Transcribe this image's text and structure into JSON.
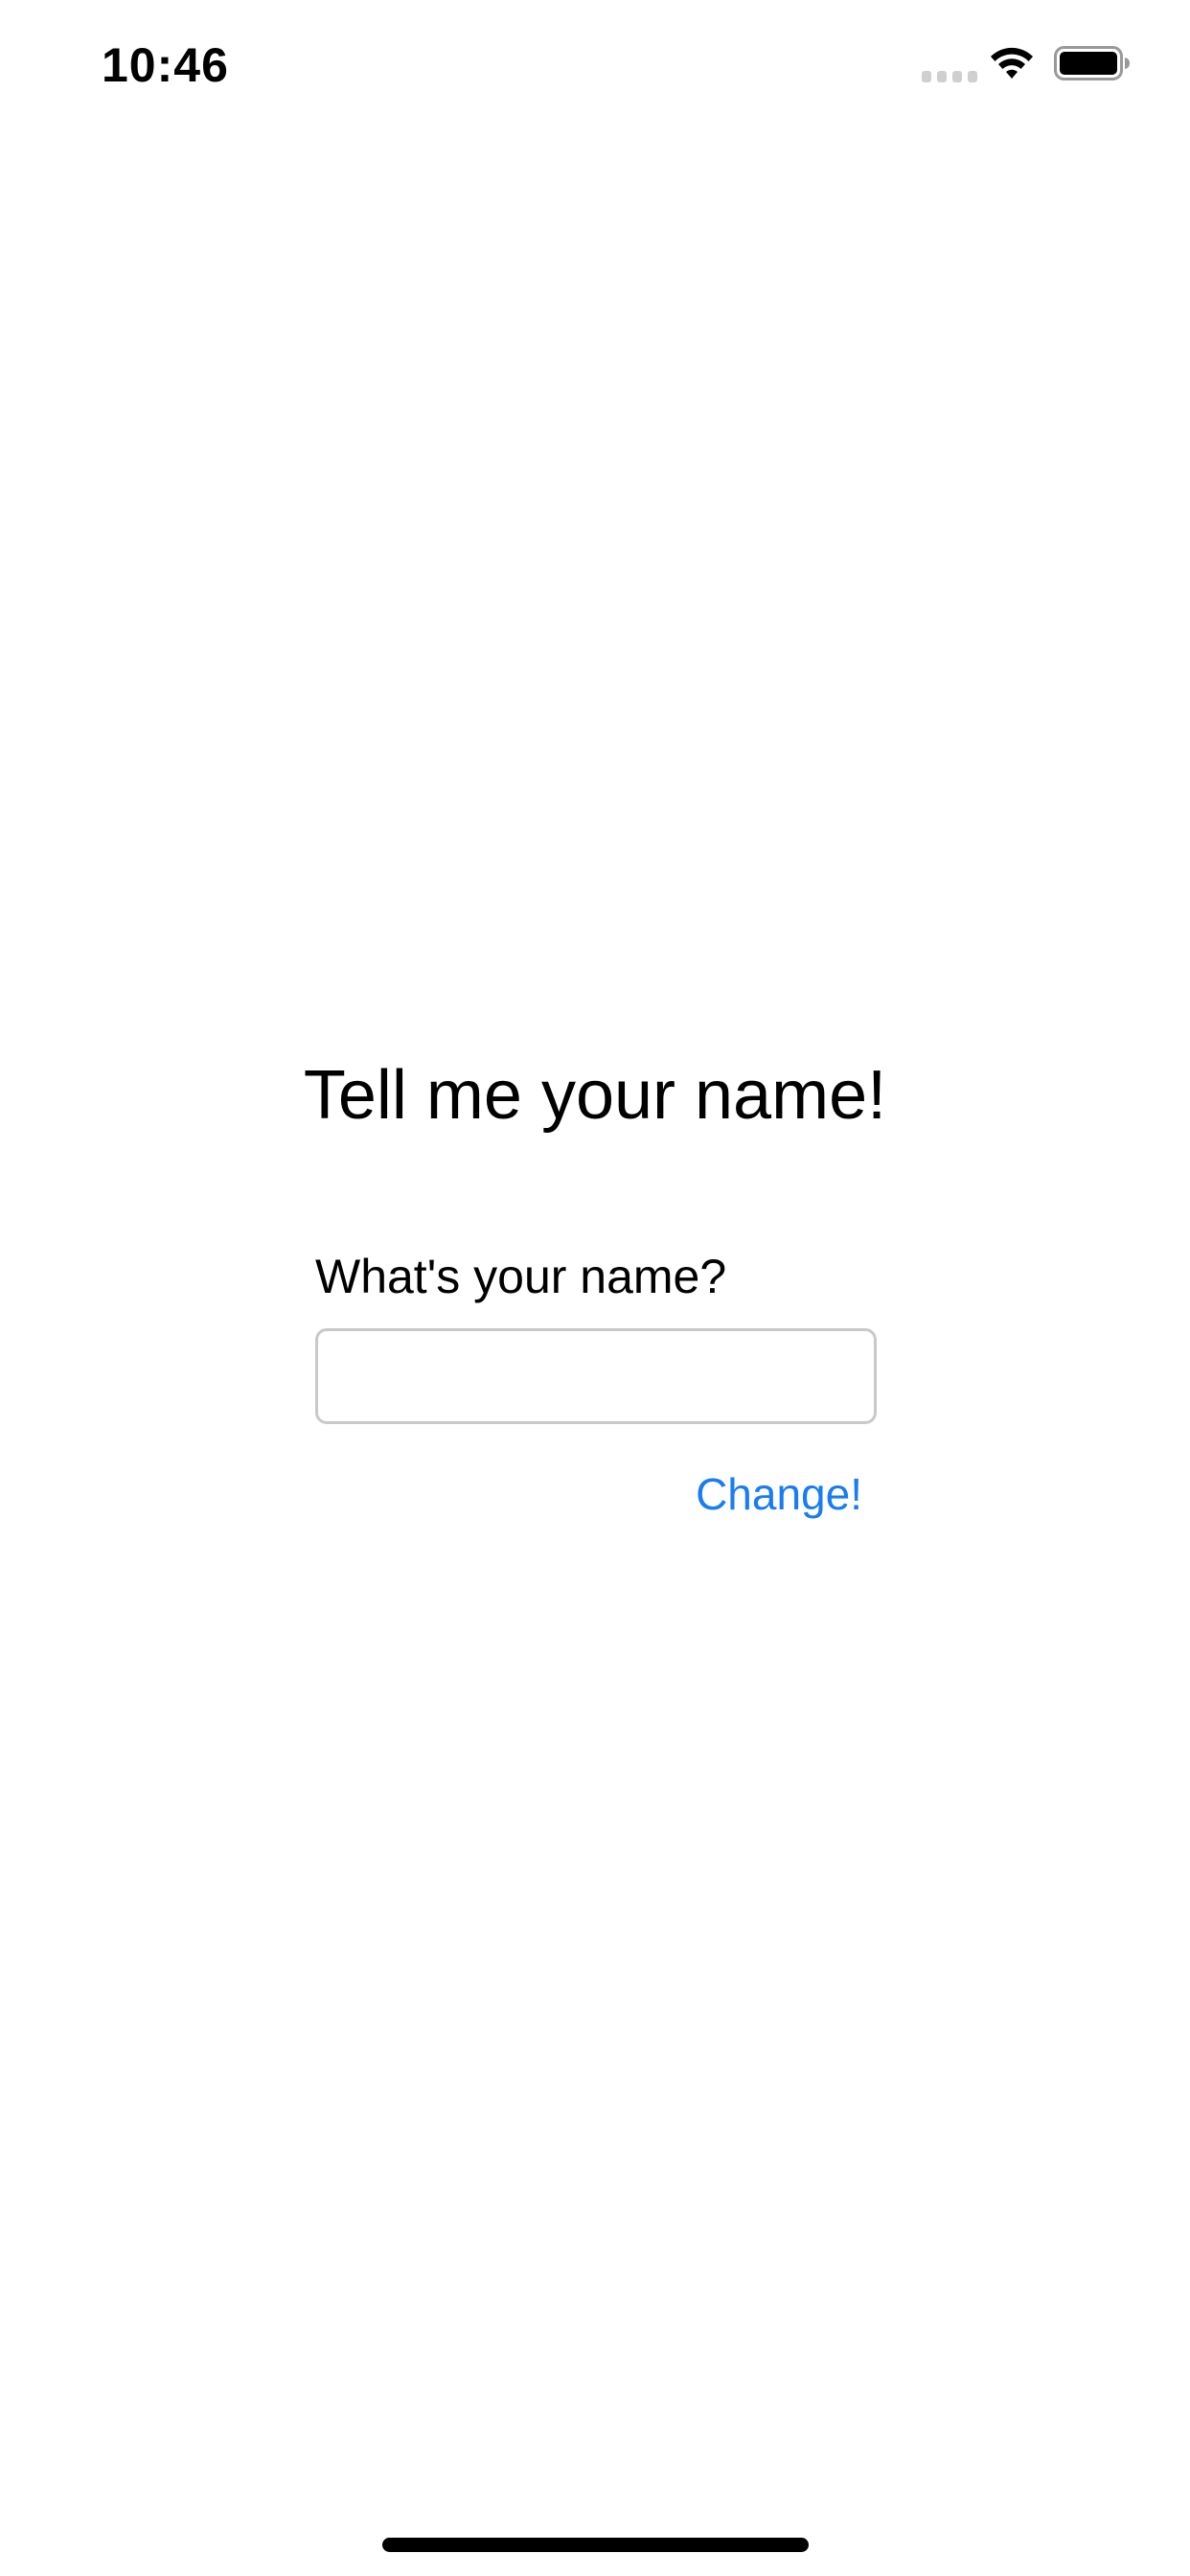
{
  "status_bar": {
    "time": "10:46",
    "icons": {
      "signal": "cellular-signal-icon",
      "wifi": "wifi-icon",
      "battery": "battery-icon"
    }
  },
  "main": {
    "title": "Tell me your name!",
    "name_label": "What's your name?",
    "name_input_value": "",
    "name_input_placeholder": "",
    "change_button_label": "Change!"
  },
  "colors": {
    "accent": "#1a7cf2",
    "text": "#000000",
    "background": "#ffffff",
    "input_border": "#c9c9c9"
  }
}
